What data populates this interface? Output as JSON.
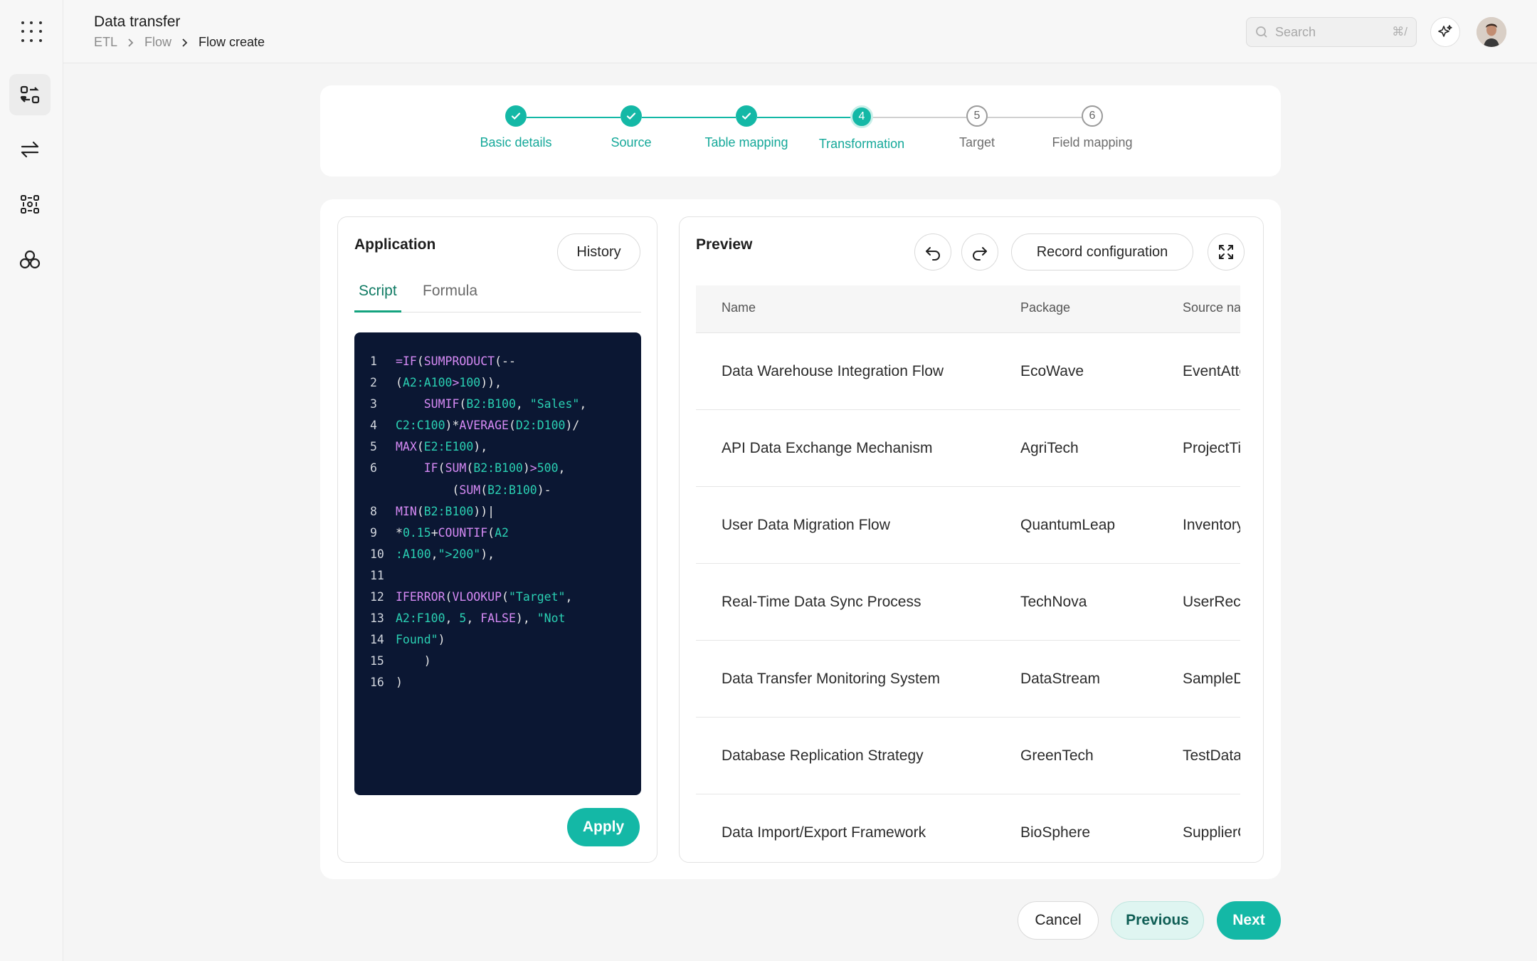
{
  "header": {
    "title": "Data transfer",
    "breadcrumb": [
      "ETL",
      "Flow",
      "Flow create"
    ],
    "search_placeholder": "Search",
    "search_shortcut": "⌘/"
  },
  "sidebar": {
    "items": [
      {
        "icon": "data-transfer-icon",
        "active": true
      },
      {
        "icon": "swap-arrows-icon",
        "active": false
      },
      {
        "icon": "workflow-grid-icon",
        "active": false
      },
      {
        "icon": "hexagon-cluster-icon",
        "active": false
      }
    ]
  },
  "stepper": {
    "steps": [
      {
        "label": "Basic details",
        "state": "done",
        "number": "1"
      },
      {
        "label": "Source",
        "state": "done",
        "number": "2"
      },
      {
        "label": "Table mapping",
        "state": "done",
        "number": "3"
      },
      {
        "label": "Transformation",
        "state": "current",
        "number": "4"
      },
      {
        "label": "Target",
        "state": "todo",
        "number": "5"
      },
      {
        "label": "Field mapping",
        "state": "todo",
        "number": "6"
      }
    ]
  },
  "application": {
    "title": "Application",
    "history_label": "History",
    "tabs": [
      "Script",
      "Formula"
    ],
    "active_tab": "Script",
    "apply_label": "Apply",
    "code_line_numbers": [
      "1",
      "2",
      "3",
      "4",
      "5",
      "6",
      "",
      "8",
      "9",
      "10",
      "11",
      "12",
      "13",
      "14",
      "15",
      "16"
    ]
  },
  "preview": {
    "title": "Preview",
    "record_config_label": "Record configuration",
    "columns": [
      "Name",
      "Package",
      "Source na"
    ],
    "rows": [
      [
        "Data Warehouse Integration Flow",
        "EcoWave",
        "EventAtte"
      ],
      [
        "API Data Exchange Mechanism",
        "AgriTech",
        "ProjectTi"
      ],
      [
        "User Data Migration Flow",
        "QuantumLeap",
        "Inventory"
      ],
      [
        "Real-Time Data Sync Process",
        "TechNova",
        "UserReco"
      ],
      [
        "Data Transfer Monitoring System",
        "DataStream",
        "SampleD"
      ],
      [
        "Database Replication Strategy",
        "GreenTech",
        "TestData"
      ],
      [
        "Data Import/Export Framework",
        "BioSphere",
        "SupplierC"
      ]
    ]
  },
  "footer": {
    "cancel_label": "Cancel",
    "previous_label": "Previous",
    "next_label": "Next"
  },
  "colors": {
    "accent": "#14b8a6",
    "code_bg": "#0b1733",
    "keyword": "#d68af5",
    "string": "#2ad0b3"
  }
}
